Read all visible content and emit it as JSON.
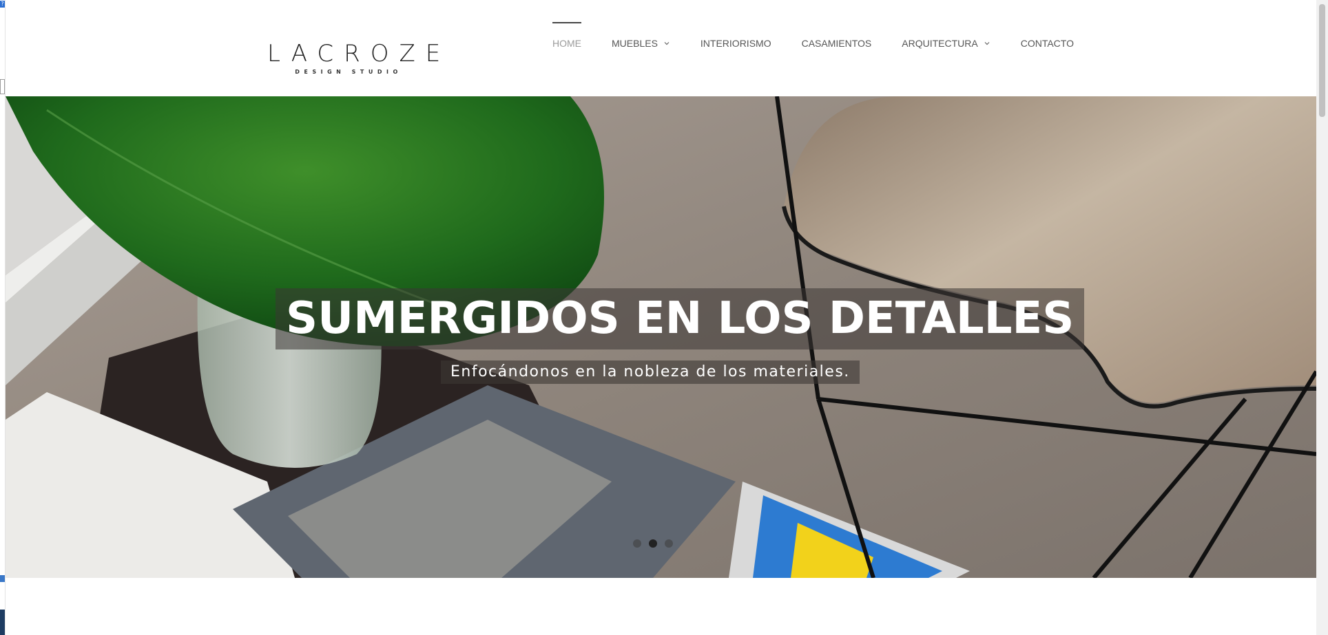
{
  "header": {
    "logo": {
      "wordmark": "LACROZE",
      "tagline": "DESIGN STUDIO"
    },
    "nav": [
      {
        "label": "HOME",
        "active": true,
        "has_dropdown": false
      },
      {
        "label": "MUEBLES",
        "active": false,
        "has_dropdown": true
      },
      {
        "label": "INTERIORISMO",
        "active": false,
        "has_dropdown": false
      },
      {
        "label": "CASAMIENTOS",
        "active": false,
        "has_dropdown": false
      },
      {
        "label": "ARQUITECTURA",
        "active": false,
        "has_dropdown": true
      },
      {
        "label": "CONTACTO",
        "active": false,
        "has_dropdown": false
      }
    ]
  },
  "hero": {
    "title": "SUMERGIDOS EN LOS DETALLES",
    "subtitle": "Enfocándonos en la nobleza de los materiales.",
    "slides": 3,
    "active_slide": 2
  },
  "browser": {
    "left_strip_icon": "help-icon"
  },
  "colors": {
    "accent_bar": "#444444",
    "nav_text": "#555555",
    "nav_active_text": "#9a9a9a",
    "caption_bg": "#3c3734"
  }
}
